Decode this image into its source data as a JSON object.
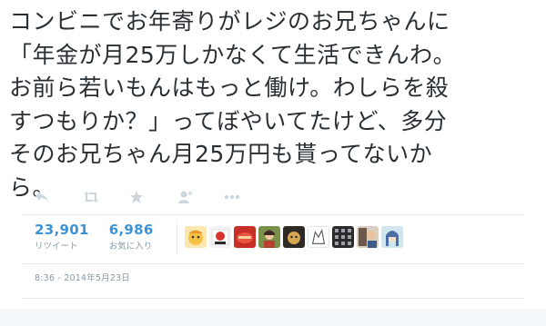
{
  "tweet": {
    "lines": [
      "コンビニでお年寄りがレジのお兄ちゃんに",
      "「年金が月25万しかなくて生活できんわ。",
      "お前ら若いもんはもっと働け。わしらを殺",
      "すつもりか？」ってぼやいてたけど、多分",
      "そのお兄ちゃん月25万円も貰ってないか",
      "ら。"
    ]
  },
  "actions": {
    "icons": [
      "reply-icon",
      "retweet-icon",
      "favorite-icon",
      "follow-icon",
      "more-icon"
    ],
    "color": "#ccd6dd"
  },
  "stats": {
    "retweets": {
      "count": "23,901",
      "label": "リツイート"
    },
    "favorites": {
      "count": "6,986",
      "label": "お気に入り"
    },
    "accent": "#3b94d9"
  },
  "favoriters": {
    "avatars": [
      "avatar-1",
      "avatar-2",
      "avatar-3",
      "avatar-4",
      "avatar-5",
      "avatar-6",
      "avatar-7",
      "avatar-8",
      "avatar-9"
    ]
  },
  "timestamp": "8:36 - 2014年5月23日"
}
